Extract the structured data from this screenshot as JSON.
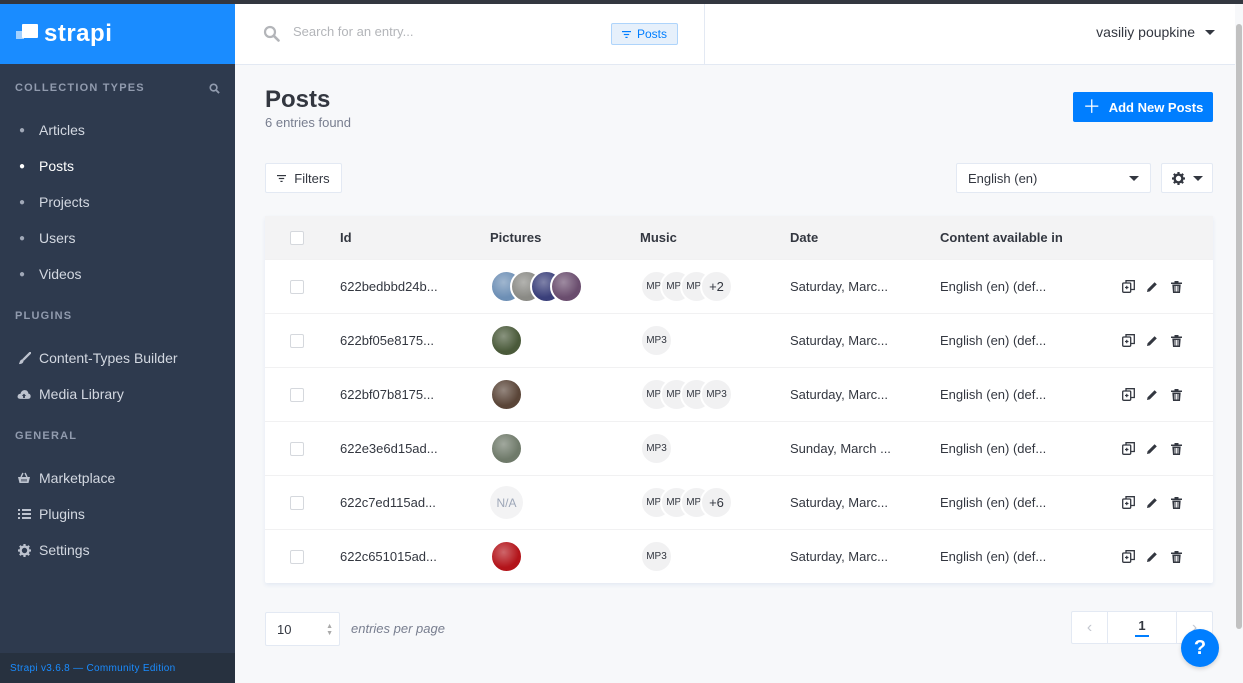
{
  "brand": {
    "name": "strapi"
  },
  "sidebar": {
    "sections": [
      {
        "title": "COLLECTION TYPES",
        "items": [
          {
            "label": "Articles",
            "active": false
          },
          {
            "label": "Posts",
            "active": true
          },
          {
            "label": "Projects",
            "active": false
          },
          {
            "label": "Users",
            "active": false
          },
          {
            "label": "Videos",
            "active": false
          }
        ]
      },
      {
        "title": "PLUGINS",
        "items": [
          {
            "label": "Content-Types Builder",
            "icon": "paint-brush-icon"
          },
          {
            "label": "Media Library",
            "icon": "cloud-upload-icon"
          }
        ]
      },
      {
        "title": "GENERAL",
        "items": [
          {
            "label": "Marketplace",
            "icon": "basket-icon"
          },
          {
            "label": "Plugins",
            "icon": "list-icon"
          },
          {
            "label": "Settings",
            "icon": "gear-icon"
          }
        ]
      }
    ],
    "footer": "Strapi v3.6.8 — Community Edition"
  },
  "header": {
    "search_placeholder": "Search for an entry...",
    "search_tag": "Posts",
    "user_name": "vasiliy poupkine"
  },
  "page": {
    "title": "Posts",
    "subtitle": "6 entries found",
    "add_button": "Add New Posts",
    "filters_button": "Filters",
    "locale": "English (en)"
  },
  "table": {
    "columns": [
      "Id",
      "Pictures",
      "Music",
      "Date",
      "Content available in"
    ],
    "rows": [
      {
        "id": "622bedbbd24b...",
        "pictures": [
          "#6d8fb5",
          "#8a8a85",
          "#3a3f7a",
          "#6a4d6e"
        ],
        "music": [
          "MP3",
          "MP3",
          "MP3"
        ],
        "music_more": "+2",
        "date": "Saturday, Marc...",
        "content": "English (en) (def..."
      },
      {
        "id": "622bf05e8175...",
        "pictures": [
          "#4a5a3a"
        ],
        "music": [
          "MP3"
        ],
        "music_more": "",
        "date": "Saturday, Marc...",
        "content": "English (en) (def..."
      },
      {
        "id": "622bf07b8175...",
        "pictures": [
          "#5a4538"
        ],
        "music": [
          "MP3",
          "MP3",
          "MP3",
          "MP3"
        ],
        "music_more": "",
        "date": "Saturday, Marc...",
        "content": "English (en) (def..."
      },
      {
        "id": "622e3e6d15ad...",
        "pictures": [
          "#6f7a6a"
        ],
        "music": [
          "MP3"
        ],
        "music_more": "",
        "date": "Sunday, March ...",
        "content": "English (en) (def..."
      },
      {
        "id": "622c7ed115ad...",
        "pictures": [],
        "pictures_empty": "N/A",
        "music": [
          "MP3",
          "MP3",
          "MP3"
        ],
        "music_more": "+6",
        "date": "Saturday, Marc...",
        "content": "English (en) (def..."
      },
      {
        "id": "622c651015ad...",
        "pictures": [
          "#b3141a"
        ],
        "music": [
          "MP3"
        ],
        "music_more": "",
        "date": "Saturday, Marc...",
        "content": "English (en) (def..."
      }
    ]
  },
  "footer": {
    "page_size": "10",
    "entries_label": "entries per page",
    "current_page": "1"
  },
  "help_label": "?",
  "colors": {
    "brand": "#1a8cff",
    "sidebar_bg": "#2e3a4e",
    "accent": "#007eff"
  }
}
